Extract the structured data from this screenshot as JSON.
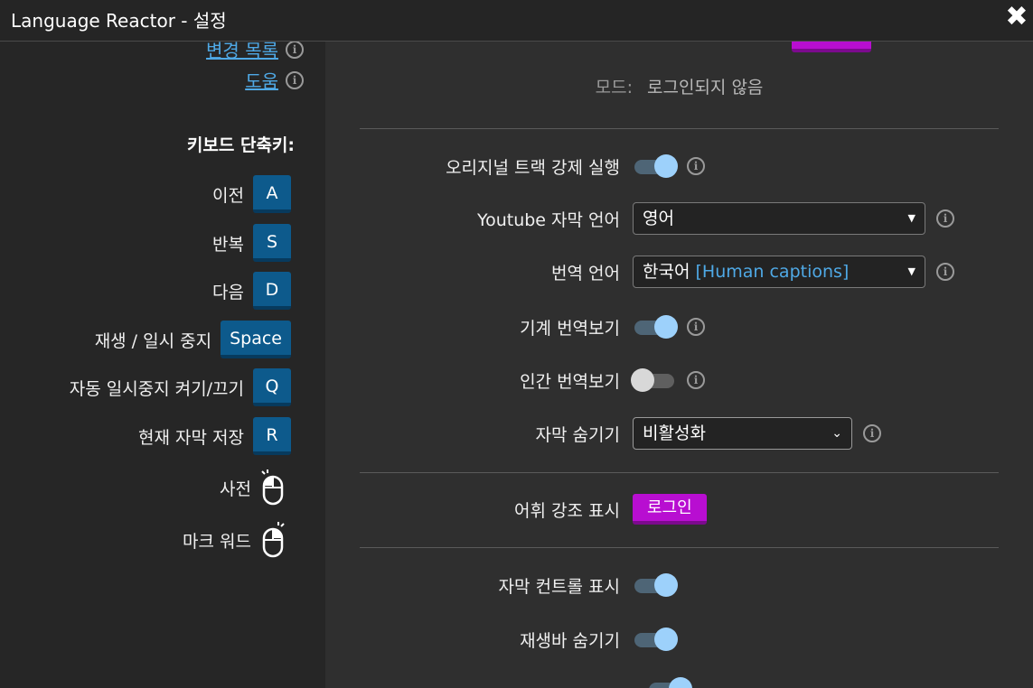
{
  "window": {
    "title": "Language Reactor - 설정",
    "close_glyph": "✖"
  },
  "sidebar": {
    "links": [
      {
        "label": "변경 목록"
      },
      {
        "label": "도움"
      }
    ],
    "keyboard_title": "키보드 단축키:",
    "shortcuts": [
      {
        "label": "이전",
        "key": "A"
      },
      {
        "label": "반복",
        "key": "S"
      },
      {
        "label": "다음",
        "key": "D"
      },
      {
        "label": "재생 / 일시 중지",
        "key": "Space"
      },
      {
        "label": "자동 일시중지 켜기/끄기",
        "key": "Q"
      },
      {
        "label": "현재 자막 저장",
        "key": "R"
      }
    ],
    "mouse_shortcuts": [
      {
        "label": "사전",
        "icon": "mouse-left-click-icon"
      },
      {
        "label": "마크 워드",
        "icon": "mouse-right-click-icon"
      }
    ]
  },
  "settings": {
    "mode_label": "모드:",
    "mode_value": "로그인되지 않음",
    "rows": {
      "force_original": {
        "label": "오리지널 트랙 강제 실행",
        "on": true
      },
      "youtube_sub_lang": {
        "label": "Youtube 자막 언어",
        "value": "영어"
      },
      "translation_lang": {
        "label": "번역 언어",
        "value": "한국어",
        "hint": "[Human captions]"
      },
      "machine_translation": {
        "label": "기계 번역보기",
        "on": true
      },
      "human_translation": {
        "label": "인간 번역보기",
        "on": false
      },
      "hide_subs": {
        "label": "자막 숨기기",
        "value": "비활성화"
      },
      "vocab_highlight": {
        "label": "어휘 강조 표시",
        "button": "로그인"
      },
      "sub_controls": {
        "label": "자막 컨트롤 표시",
        "on": true
      },
      "hide_playbar": {
        "label": "재생바 숨기기",
        "on": true
      }
    }
  },
  "colors": {
    "accent": "#4fa9e6",
    "key_bg": "#0d5a8c",
    "login_bg": "#b80ed1",
    "toggle_on": "#9dd1fb"
  }
}
